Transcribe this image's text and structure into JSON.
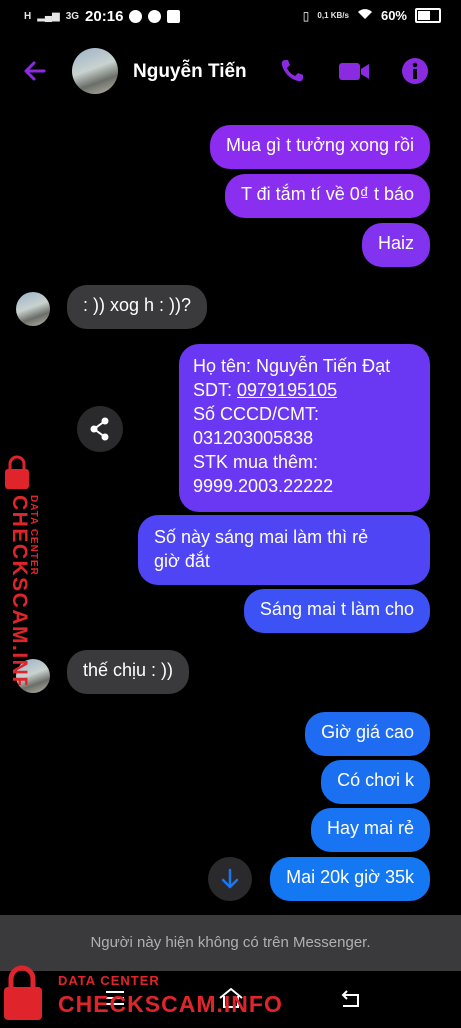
{
  "status_bar": {
    "network": "H",
    "network2": "3G",
    "time": "20:16",
    "speed": "0,1 KB/s",
    "battery": "60%"
  },
  "header": {
    "contact_name": "Nguyễn Tiến",
    "accent": "#8a2be2"
  },
  "messages": [
    {
      "dir": "out",
      "text": "Mua gì t tưởng xong rồi"
    },
    {
      "dir": "out",
      "text": "T đi tắm tí về 0₫ t báo"
    },
    {
      "dir": "out",
      "text": "Haiz"
    },
    {
      "dir": "in",
      "text": ": )) xog h : ))?"
    },
    {
      "dir": "out",
      "lines": [
        "Họ tên: Nguyễn Tiến Đạt",
        "SDT: 0979195105",
        "Số CCCD/CMT:",
        "031203005838",
        "STK mua thêm:",
        "9999.2003.22222"
      ]
    },
    {
      "dir": "out",
      "lines": [
        "Số này sáng mai làm thì rẻ",
        "giờ đắt"
      ]
    },
    {
      "dir": "out",
      "text": "Sáng mai t làm cho"
    },
    {
      "dir": "in",
      "text": "thế chịu : ))"
    },
    {
      "dir": "out",
      "text": "Giờ giá cao"
    },
    {
      "dir": "out",
      "text": "Có chơi k"
    },
    {
      "dir": "out",
      "text": "Hay mai rẻ"
    },
    {
      "dir": "out",
      "text": "Mai 20k giờ 35k"
    }
  ],
  "footer": {
    "notice": "Người này hiện không có trên Messenger."
  },
  "watermark": {
    "brand": "CHECKSCAM.INFO",
    "tagline": "DATA CENTER"
  },
  "icons": [
    "back-arrow-icon",
    "phone-icon",
    "video-camera-icon",
    "info-icon",
    "share-icon",
    "arrow-down-icon",
    "lock-icon"
  ]
}
